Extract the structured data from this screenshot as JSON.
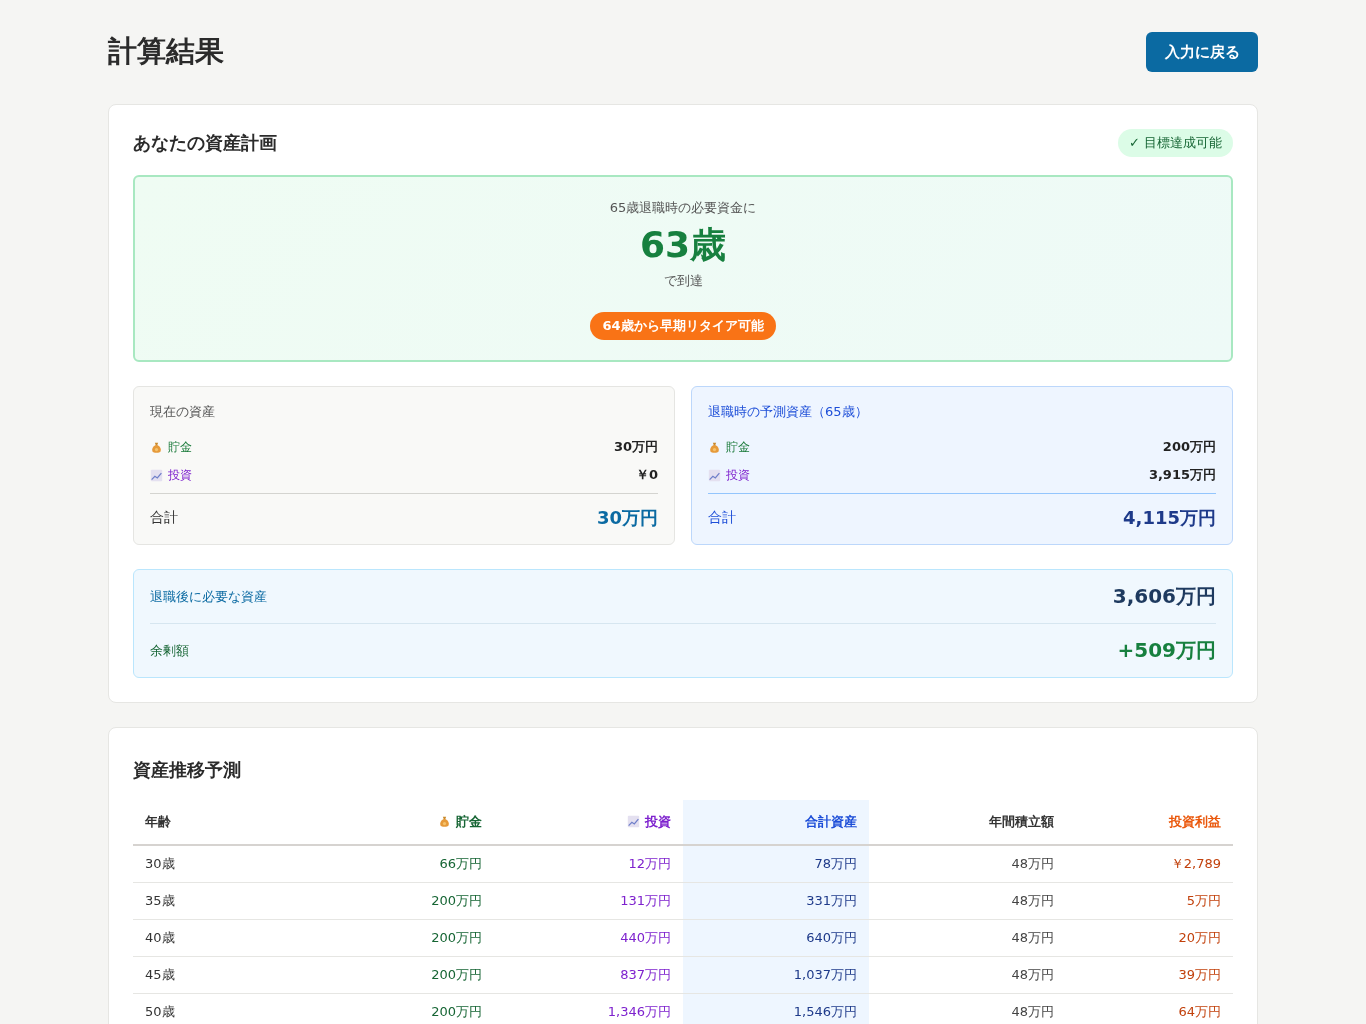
{
  "page": {
    "title": "計算結果",
    "back_button": "入力に戻る"
  },
  "plan": {
    "heading": "あなたの資産計画",
    "status_badge": "✓ 目標達成可能",
    "hero": {
      "caption": "65歳退職時の必要資金に",
      "age": "63歳",
      "suffix": "で到達",
      "early_retire": "64歳から早期リタイア可能"
    },
    "panels": [
      {
        "kind": "current",
        "title": "現在の資産",
        "items": [
          {
            "kind": "savings",
            "label": "貯金",
            "value": "30万円"
          },
          {
            "kind": "investment",
            "label": "投資",
            "value": "￥0"
          }
        ],
        "total_label": "合計",
        "total_value": "30万円"
      },
      {
        "kind": "retirement",
        "title": "退職時の予測資産（65歳）",
        "items": [
          {
            "kind": "savings",
            "label": "貯金",
            "value": "200万円"
          },
          {
            "kind": "investment",
            "label": "投資",
            "value": "3,915万円"
          }
        ],
        "total_label": "合計",
        "total_value": "4,115万円"
      }
    ],
    "summary": [
      {
        "kind": "required",
        "label": "退職後に必要な資産",
        "value": "3,606万円"
      },
      {
        "kind": "surplus",
        "label": "余剰額",
        "value": "+509万円"
      }
    ]
  },
  "projection": {
    "heading": "資産推移予測",
    "table": {
      "columns": [
        {
          "kind": "age",
          "label": "年齢"
        },
        {
          "kind": "savings",
          "label": "貯金"
        },
        {
          "kind": "investment",
          "label": "投資"
        },
        {
          "kind": "total",
          "label": "合計資産"
        },
        {
          "kind": "annual",
          "label": "年間積立額"
        },
        {
          "kind": "profit",
          "label": "投資利益"
        }
      ],
      "rows": [
        [
          "30歳",
          "66万円",
          "12万円",
          "78万円",
          "48万円",
          "￥2,789"
        ],
        [
          "35歳",
          "200万円",
          "131万円",
          "331万円",
          "48万円",
          "5万円"
        ],
        [
          "40歳",
          "200万円",
          "440万円",
          "640万円",
          "48万円",
          "20万円"
        ],
        [
          "45歳",
          "200万円",
          "837万円",
          "1,037万円",
          "48万円",
          "39万円"
        ],
        [
          "50歳",
          "200万円",
          "1,346万円",
          "1,546万円",
          "48万円",
          "64万円"
        ]
      ]
    }
  }
}
